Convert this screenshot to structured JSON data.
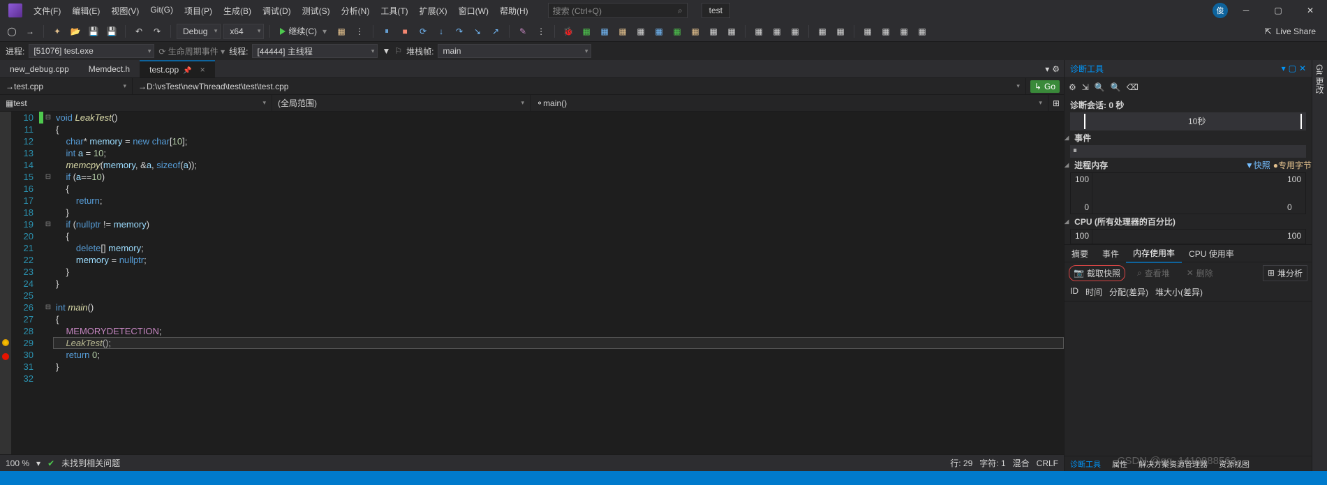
{
  "menu": {
    "items": [
      "文件(F)",
      "编辑(E)",
      "视图(V)",
      "Git(G)",
      "项目(P)",
      "生成(B)",
      "调试(D)",
      "测试(S)",
      "分析(N)",
      "工具(T)",
      "扩展(X)",
      "窗口(W)",
      "帮助(H)"
    ]
  },
  "search": {
    "placeholder": "搜索 (Ctrl+Q)"
  },
  "config_name": "test",
  "user_initial": "俊",
  "toolbar": {
    "config": "Debug",
    "platform": "x64",
    "run": "继续(C)"
  },
  "live_share": "Live Share",
  "debug": {
    "process_label": "进程:",
    "process": "[51076] test.exe",
    "lifecycle": "生命周期事件",
    "thread_label": "线程:",
    "thread": "[44444] 主线程",
    "stack_label": "堆栈帧:",
    "stack": "main"
  },
  "tabs": [
    "new_debug.cpp",
    "Memdect.h",
    "test.cpp"
  ],
  "nav": {
    "file": "test.cpp",
    "path": "D:\\vsTest\\newThread\\test\\test\\test.cpp",
    "go": "Go"
  },
  "scope": {
    "project": "test",
    "scope": "(全局范围)",
    "func": "main()"
  },
  "lines": {
    "start": 10,
    "end": 32
  },
  "code": [
    {
      "n": 10,
      "h": "<span class='kw'>void</span> <span class='fn'>LeakTest</span>()"
    },
    {
      "n": 11,
      "h": "{"
    },
    {
      "n": 12,
      "h": "    <span class='type'>char</span>* <span class='ident'>memory</span> = <span class='kw'>new</span> <span class='type'>char</span>[<span class='num'>10</span>];"
    },
    {
      "n": 13,
      "h": "    <span class='type'>int</span> <span class='ident'>a</span> = <span class='num'>10</span>;"
    },
    {
      "n": 14,
      "h": "    <span class='fn'>memcpy</span>(<span class='ident'>memory</span>, &amp;<span class='ident'>a</span>, <span class='kw'>sizeof</span>(<span class='ident'>a</span>));"
    },
    {
      "n": 15,
      "h": "    <span class='kw'>if</span> (<span class='ident'>a</span>==<span class='num'>10</span>)"
    },
    {
      "n": 16,
      "h": "    {"
    },
    {
      "n": 17,
      "h": "        <span class='kw'>return</span>;"
    },
    {
      "n": 18,
      "h": "    }"
    },
    {
      "n": 19,
      "h": "    <span class='kw'>if</span> (<span class='kw'>nullptr</span> != <span class='ident'>memory</span>)"
    },
    {
      "n": 20,
      "h": "    {"
    },
    {
      "n": 21,
      "h": "        <span class='kw'>delete</span>[] <span class='ident'>memory</span>;"
    },
    {
      "n": 22,
      "h": "        <span class='ident'>memory</span> = <span class='kw'>nullptr</span>;"
    },
    {
      "n": 23,
      "h": "    }"
    },
    {
      "n": 24,
      "h": "}"
    },
    {
      "n": 25,
      "h": ""
    },
    {
      "n": 26,
      "h": "<span class='type'>int</span> <span class='fn'>main</span>()"
    },
    {
      "n": 27,
      "h": "{"
    },
    {
      "n": 28,
      "h": "    <span class='macro'>MEMORYDETECTION</span>;"
    },
    {
      "n": 29,
      "h": "    <span class='fn'>LeakTest</span>();"
    },
    {
      "n": 30,
      "h": "    <span class='kw'>return</span> <span class='num'>0</span>;"
    },
    {
      "n": 31,
      "h": "}"
    },
    {
      "n": 32,
      "h": ""
    }
  ],
  "breakpoints": {
    "29": "arrow",
    "30": "red"
  },
  "folds": {
    "10": "⊟",
    "15": "⊟",
    "19": "⊟",
    "26": "⊟"
  },
  "status": {
    "zoom": "100 %",
    "issues": "未找到相关问题",
    "line": "行: 29",
    "col": "字符: 1",
    "ins": "混合",
    "eol": "CRLF"
  },
  "diag": {
    "title": "诊断工具",
    "session": "诊断会话: 0 秒",
    "tenSec": "10秒",
    "events": "事件",
    "memory_title": "进程内存",
    "snapshot_lbl": "快照",
    "private_bytes": "专用字节",
    "mem_top": "100",
    "mem_bot": "0",
    "cpu_title": "CPU (所有处理器的百分比)",
    "cpu_top": "100",
    "cpu_bot": "100",
    "tabs": [
      "摘要",
      "事件",
      "内存使用率",
      "CPU 使用率"
    ],
    "snap": "截取快照",
    "view_heap": "查看堆",
    "delete": "删除",
    "heap_analysis": "堆分析",
    "cols": [
      "ID",
      "时间",
      "分配(差异)",
      "堆大小(差异)"
    ]
  },
  "bottom_tabs": [
    "诊断工具",
    "属性",
    "解决方案资源管理器",
    "资源视图"
  ],
  "side_label": "Git 更改",
  "watermark": "CSDN @qq_1410888563"
}
